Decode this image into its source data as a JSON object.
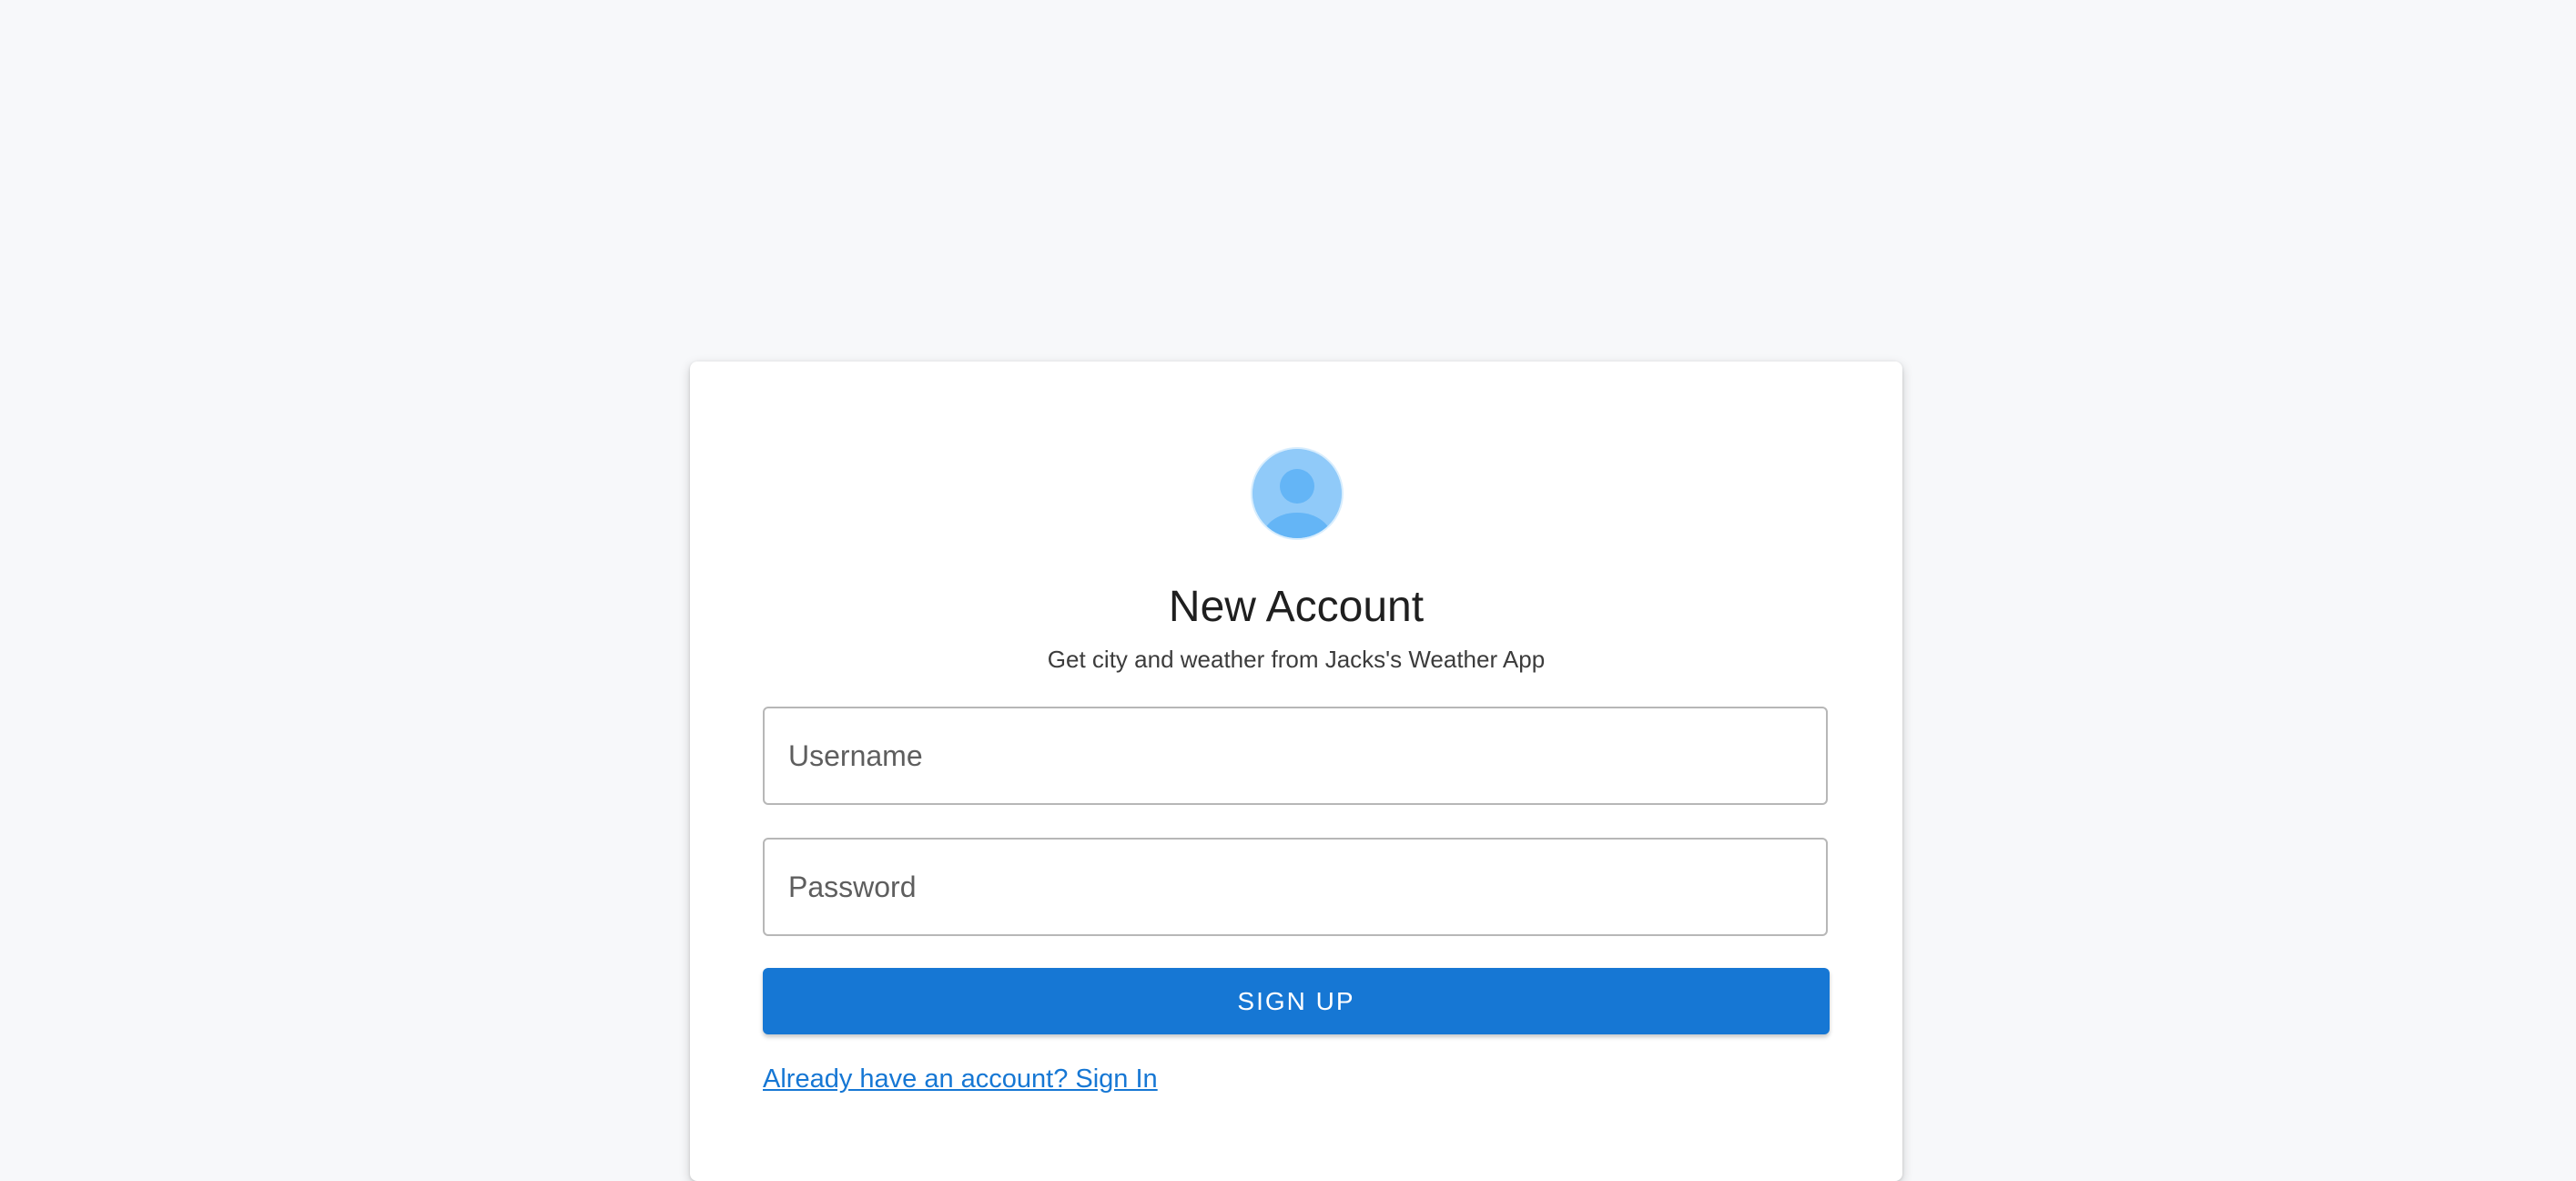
{
  "page": {
    "background": "#f7f8fa"
  },
  "card": {
    "avatar_icon": "user-avatar-icon",
    "title": "New Account",
    "subtitle": "Get city and weather from Jacks's Weather App",
    "username": {
      "placeholder": "Username",
      "value": ""
    },
    "password": {
      "placeholder": "Password",
      "value": ""
    },
    "signup_label": "SIGN UP",
    "signin_link": "Already have an account? Sign In"
  },
  "colors": {
    "accent": "#1677d4",
    "avatar_bg": "#90caf9",
    "avatar_fg": "#64b5f6"
  }
}
